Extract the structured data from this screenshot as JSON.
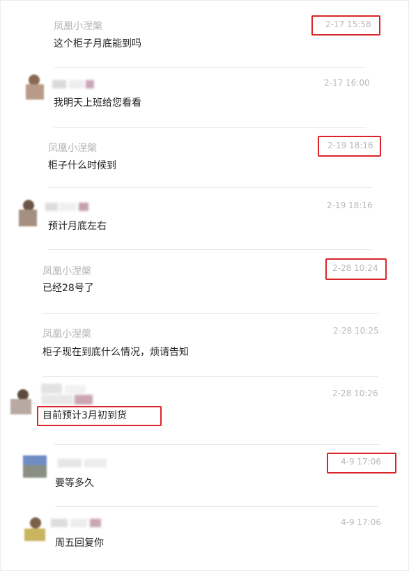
{
  "messages": [
    {
      "sender": "凤凰小涅槃",
      "text": "这个柜子月底能到吗",
      "time": "2-17 15:58"
    },
    {
      "sender": "",
      "text": "我明天上班给您看看",
      "time": "2-17 16:00"
    },
    {
      "sender": "凤凰小涅槃",
      "text": "柜子什么时候到",
      "time": "2-19 18:16"
    },
    {
      "sender": "",
      "text": "预计月底左右",
      "time": "2-19 18:16"
    },
    {
      "sender": "凤凰小涅槃",
      "text": "已经28号了",
      "time": "2-28 10:24"
    },
    {
      "sender": "凤凰小涅槃",
      "text": "柜子现在到底什么情况，烦请告知",
      "time": "2-28 10:25"
    },
    {
      "sender": "",
      "text": "目前预计3月初到货",
      "time": "2-28 10:26"
    },
    {
      "sender": "",
      "text": "要等多久",
      "time": "4-9 17:06"
    },
    {
      "sender": "",
      "text": "周五回复你",
      "time": "4-9 17:06"
    }
  ],
  "colors": {
    "highlight": "#d9252a",
    "name": "#b3b3b3",
    "text": "#222222",
    "time": "#b9b9b9"
  }
}
